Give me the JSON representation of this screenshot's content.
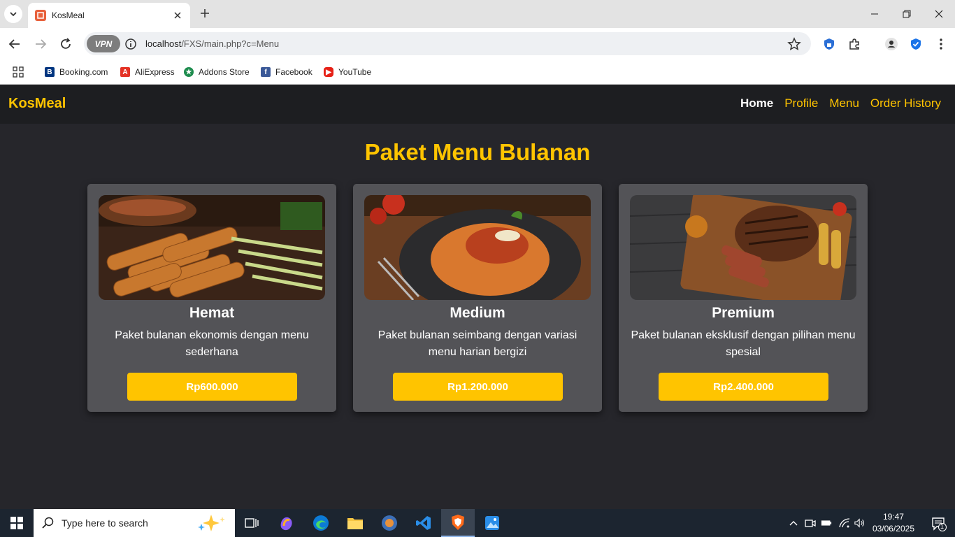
{
  "browser": {
    "tab_title": "KosMeal",
    "url_host": "localhost",
    "url_path": "/FXS/main.php?c=Menu",
    "vpn_label": "VPN",
    "bookmarks": [
      "Booking.com",
      "AliExpress",
      "Addons Store",
      "Facebook",
      "YouTube"
    ]
  },
  "site": {
    "brand": "KosMeal",
    "nav": [
      "Home",
      "Profile",
      "Menu",
      "Order History"
    ],
    "section_title": "Paket Menu Bulanan",
    "packages": [
      {
        "name": "Hemat",
        "desc": "Paket bulanan ekonomis dengan menu sederhana",
        "price": "Rp600.000"
      },
      {
        "name": "Medium",
        "desc": "Paket bulanan seimbang dengan variasi menu harian bergizi",
        "price": "Rp1.200.000"
      },
      {
        "name": "Premium",
        "desc": "Paket bulanan eksklusif dengan pilihan menu spesial",
        "price": "Rp2.400.000"
      }
    ]
  },
  "taskbar": {
    "search_placeholder": "Type here to search",
    "time": "19:47",
    "date": "03/06/2025",
    "notif_count": "1"
  },
  "colors": {
    "accent": "#ffc400",
    "page_bg": "#26262b",
    "card_bg": "#535357",
    "header_bg": "#1d1e21"
  }
}
